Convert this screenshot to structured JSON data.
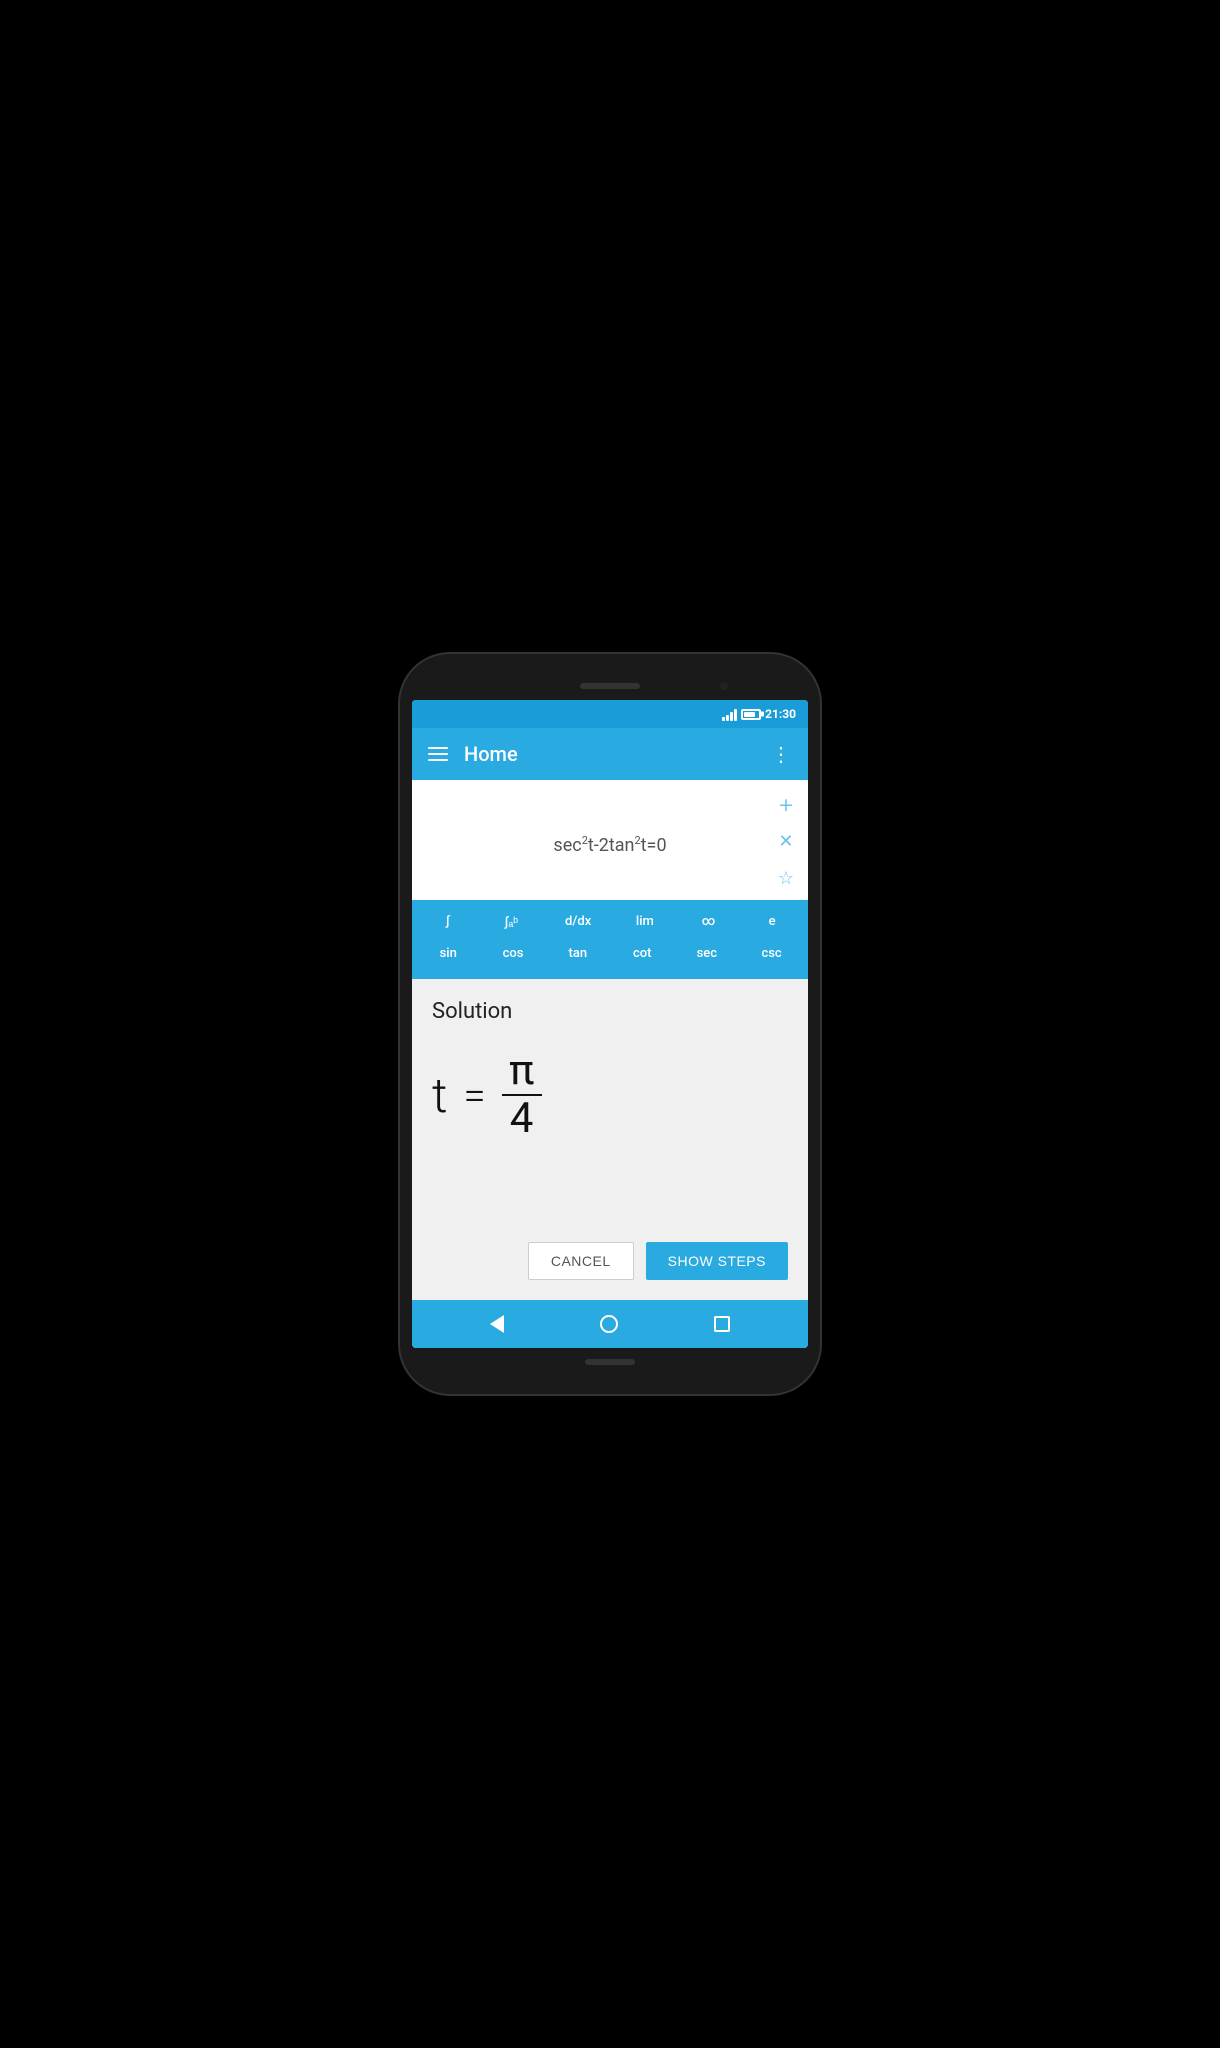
{
  "status_bar": {
    "time": "21:30"
  },
  "app_bar": {
    "title": "Home",
    "menu_icon": "⋮"
  },
  "equation": {
    "display": "sec²t-2tan²t=0"
  },
  "keyboard": {
    "row1": [
      "∫",
      "∫ₐᵇ",
      "d/dx",
      "lim",
      "∞",
      "e"
    ],
    "row2": [
      "sin",
      "cos",
      "tan",
      "cot",
      "sec",
      "csc"
    ]
  },
  "solution": {
    "title": "Solution",
    "variable": "t",
    "equals": "=",
    "numerator": "π",
    "denominator": "4"
  },
  "buttons": {
    "cancel": "Cancel",
    "show_steps": "Show steps"
  },
  "nav": {
    "back": "back",
    "home": "home",
    "recents": "recents"
  }
}
